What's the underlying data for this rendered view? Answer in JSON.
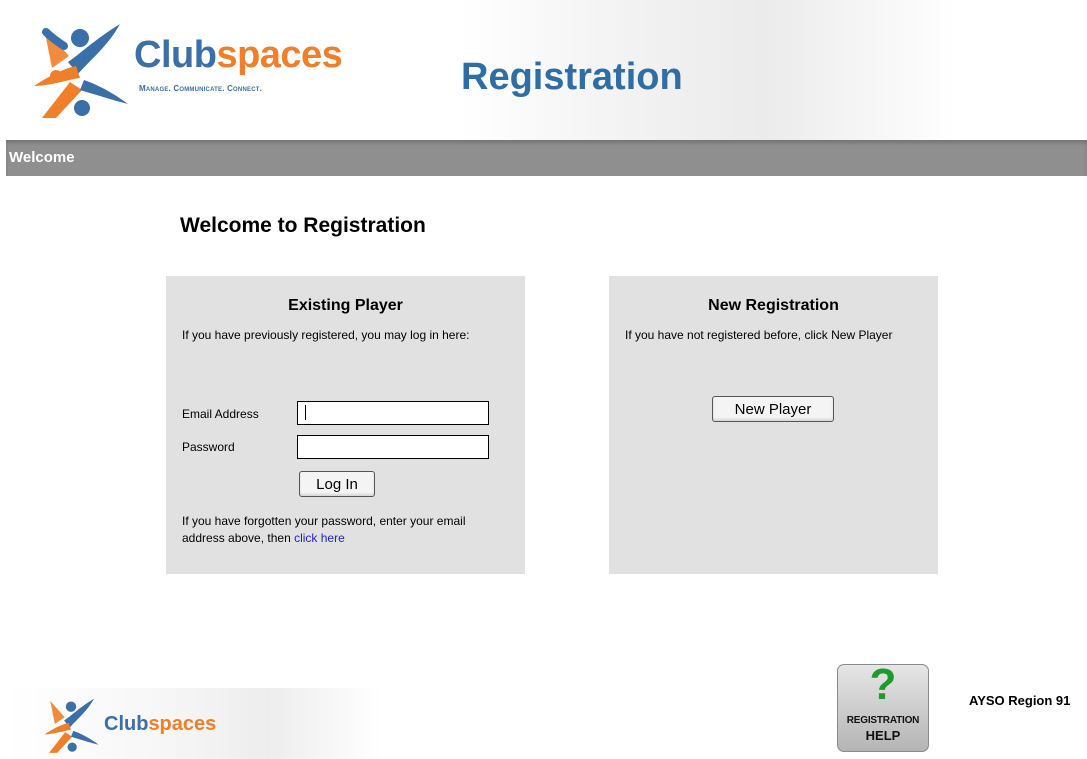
{
  "header": {
    "brand_club": "Club",
    "brand_spaces": "spaces",
    "tagline": "Manage. Communicate. Connect.",
    "page_title": "Registration"
  },
  "nav": {
    "section_title": "Welcome"
  },
  "main": {
    "title": "Welcome to Registration"
  },
  "existing_player": {
    "heading": "Existing Player",
    "intro": "If you have previously registered, you may log in here:",
    "email_label": "Email Address",
    "email_value": "",
    "password_label": "Password",
    "password_value": "",
    "login_button": "Log In",
    "forgot_text": "If you have forgotten your password, enter your email address above, then",
    "forgot_link": "click here"
  },
  "new_registration": {
    "heading": "New Registration",
    "intro": "If you have not registered before, click New Player",
    "new_player_button": "New Player"
  },
  "footer": {
    "brand_club": "Club",
    "brand_spaces": "spaces",
    "help_line1": "REGISTRATION",
    "help_line2": "HELP",
    "organization": "AYSO Region 91"
  },
  "colors": {
    "brand_blue": "#3a6fa7",
    "brand_orange": "#ef7f2a",
    "title_blue": "#2f6ea5",
    "bar_gray": "#8f8f8f",
    "panel_gray": "#e1e1e1",
    "help_green": "#1f9a2c",
    "link_blue": "#2222cc"
  },
  "icons": {
    "logo": "clubspaces-logo-icon",
    "help": "question-mark-icon"
  }
}
